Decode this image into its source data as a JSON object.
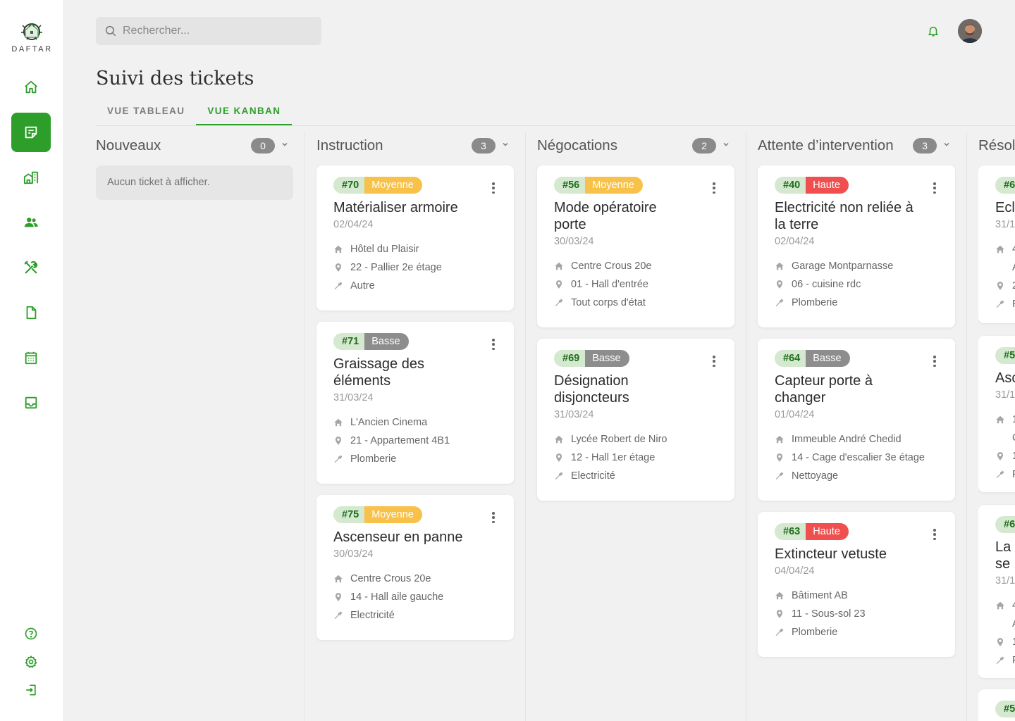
{
  "brand": {
    "name": "DAFTAR"
  },
  "sidebar": {
    "items": [
      {
        "icon": "home-icon",
        "label": "Accueil"
      },
      {
        "icon": "tickets-icon",
        "label": "Tickets",
        "active": true
      },
      {
        "icon": "buildings-icon",
        "label": "Bâtiments"
      },
      {
        "icon": "users-icon",
        "label": "Utilisateurs"
      },
      {
        "icon": "tools-icon",
        "label": "Interventions"
      },
      {
        "icon": "document-icon",
        "label": "Documents"
      },
      {
        "icon": "calendar-icon",
        "label": "Calendrier"
      },
      {
        "icon": "inbox-icon",
        "label": "Boîte de réception"
      }
    ],
    "bottom": [
      {
        "icon": "help-icon"
      },
      {
        "icon": "settings-icon"
      },
      {
        "icon": "logout-icon"
      }
    ]
  },
  "search": {
    "placeholder": "Rechercher..."
  },
  "header": {
    "title": "Suivi des tickets"
  },
  "tabs": [
    {
      "label": "VUE TABLEAU",
      "active": false
    },
    {
      "label": "VUE KANBAN",
      "active": true
    }
  ],
  "columns": [
    {
      "title": "Nouveaux",
      "count": "0",
      "empty": "Aucun ticket à afficher.",
      "cards": []
    },
    {
      "title": "Instruction",
      "count": "3",
      "cards": [
        {
          "id": "#70",
          "priority": "Moyenne",
          "level": "moyenne",
          "title": "Matérialiser armoire",
          "date": "02/04/24",
          "site": "Hôtel du Plaisir",
          "location": "22 - Pallier 2e étage",
          "trade": "Autre"
        },
        {
          "id": "#71",
          "priority": "Basse",
          "level": "basse",
          "title": "Graissage des éléments",
          "date": "31/03/24",
          "site": "L'Ancien Cinema",
          "location": "21 - Appartement 4B1",
          "trade": "Plomberie"
        },
        {
          "id": "#75",
          "priority": "Moyenne",
          "level": "moyenne",
          "title": "Ascenseur en panne",
          "date": "30/03/24",
          "site": "Centre Crous 20e",
          "location": "14 - Hall aile gauche",
          "trade": "Electricité"
        }
      ]
    },
    {
      "title": "Négocations",
      "count": "2",
      "cards": [
        {
          "id": "#56",
          "priority": "Moyenne",
          "level": "moyenne",
          "title": "Mode opératoire porte",
          "date": "30/03/24",
          "site": "Centre Crous 20e",
          "location": "01 - Hall d'entrée",
          "trade": "Tout corps d'état"
        },
        {
          "id": "#69",
          "priority": "Basse",
          "level": "basse",
          "title": "Désignation disjoncteurs",
          "date": "31/03/24",
          "site": "Lycée Robert de Niro",
          "location": "12 - Hall 1er étage",
          "trade": "Electricité"
        }
      ]
    },
    {
      "title": "Attente d’intervention",
      "count": "3",
      "cards": [
        {
          "id": "#40",
          "priority": "Haute",
          "level": "haute",
          "title": "Electricité non reliée à la terre",
          "date": "02/04/24",
          "site": "Garage Montparnasse",
          "location": "06 - cuisine rdc",
          "trade": "Plomberie"
        },
        {
          "id": "#64",
          "priority": "Basse",
          "level": "basse",
          "title": "Capteur porte à changer",
          "date": "01/04/24",
          "site": "Immeuble André Chedid",
          "location": "14 - Cage d'escalier 3e étage",
          "trade": "Nettoyage"
        },
        {
          "id": "#63",
          "priority": "Haute",
          "level": "haute",
          "title": "Extincteur vetuste",
          "date": "04/04/24",
          "site": "Bâtiment AB",
          "location": "11 - Sous-sol 23",
          "trade": "Plomberie"
        }
      ]
    }
  ],
  "partial_column": {
    "title": "Résol",
    "cards": [
      {
        "id": "#6",
        "title": "Ecl",
        "date": "31/1",
        "site": "4",
        "site2": "A",
        "location": "2",
        "trade": "F"
      },
      {
        "id": "#5",
        "title": "Asc",
        "date": "31/1",
        "site": "1",
        "site2": "C",
        "location": "1",
        "trade": "F"
      },
      {
        "id": "#6",
        "title": "La",
        "title2": "se",
        "date": "31/1",
        "site": "4",
        "site2": "A",
        "location": "1",
        "trade": "F"
      },
      {
        "id": "#5"
      }
    ]
  },
  "colors": {
    "accent": "#2e9e2a",
    "moyenne": "#f8c14a",
    "basse": "#8d8d8d",
    "haute": "#ef4f4f",
    "id_bg": "#d4e9cf"
  }
}
